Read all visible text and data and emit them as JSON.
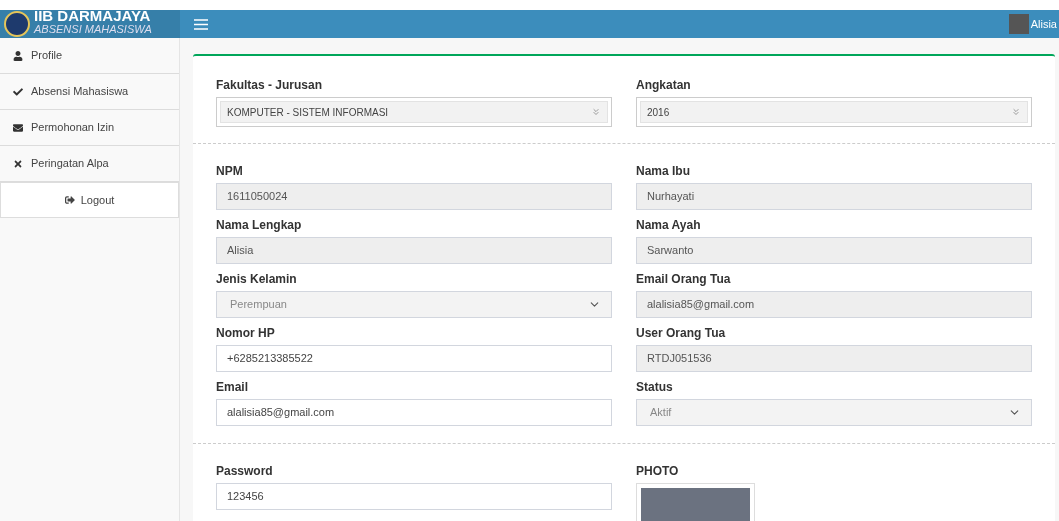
{
  "top_bar": {
    "logo_title": "IIB DARMAJAYA",
    "logo_subtitle": "ABSENSI MAHASISWA",
    "user_name": "Alisia"
  },
  "sidebar": {
    "items": [
      {
        "label": "Profile"
      },
      {
        "label": "Absensi Mahasiswa"
      },
      {
        "label": "Permohonan Izin"
      },
      {
        "label": "Peringatan Alpa"
      }
    ],
    "logout": "Logout"
  },
  "sections": [
    {
      "fields": [
        {
          "label": "Fakultas - Jurusan",
          "kind": "choice",
          "value": "KOMPUTER - SISTEM INFORMASI"
        },
        {
          "label": "Angkatan",
          "kind": "choice",
          "value": "2016"
        }
      ]
    },
    {
      "fields": [
        {
          "label": "NPM",
          "kind": "text",
          "value": "1611050024",
          "disabled": true
        },
        {
          "label": "Nama Ibu",
          "kind": "text",
          "value": "Nurhayati",
          "disabled": true
        },
        {
          "label": "Nama Lengkap",
          "kind": "text",
          "value": "Alisia",
          "disabled": true
        },
        {
          "label": "Nama Ayah",
          "kind": "text",
          "value": "Sarwanto",
          "disabled": true
        },
        {
          "label": "Jenis Kelamin",
          "kind": "select",
          "value": "Perempuan",
          "disabled": true
        },
        {
          "label": "Email Orang Tua",
          "kind": "text",
          "value": "alalisia85@gmail.com",
          "disabled": true
        },
        {
          "label": "Nomor HP",
          "kind": "text",
          "value": "+6285213385522",
          "disabled": false
        },
        {
          "label": "User Orang Tua",
          "kind": "text",
          "value": "RTDJ051536",
          "disabled": true
        },
        {
          "label": "Email",
          "kind": "text",
          "value": "alalisia85@gmail.com",
          "disabled": false
        },
        {
          "label": "Status",
          "kind": "select",
          "value": "Aktif",
          "disabled": true
        }
      ]
    },
    {
      "fields": [
        {
          "label": "Password",
          "kind": "text",
          "value": "123456",
          "disabled": false
        },
        {
          "label": "PHOTO",
          "kind": "photo"
        }
      ]
    }
  ]
}
